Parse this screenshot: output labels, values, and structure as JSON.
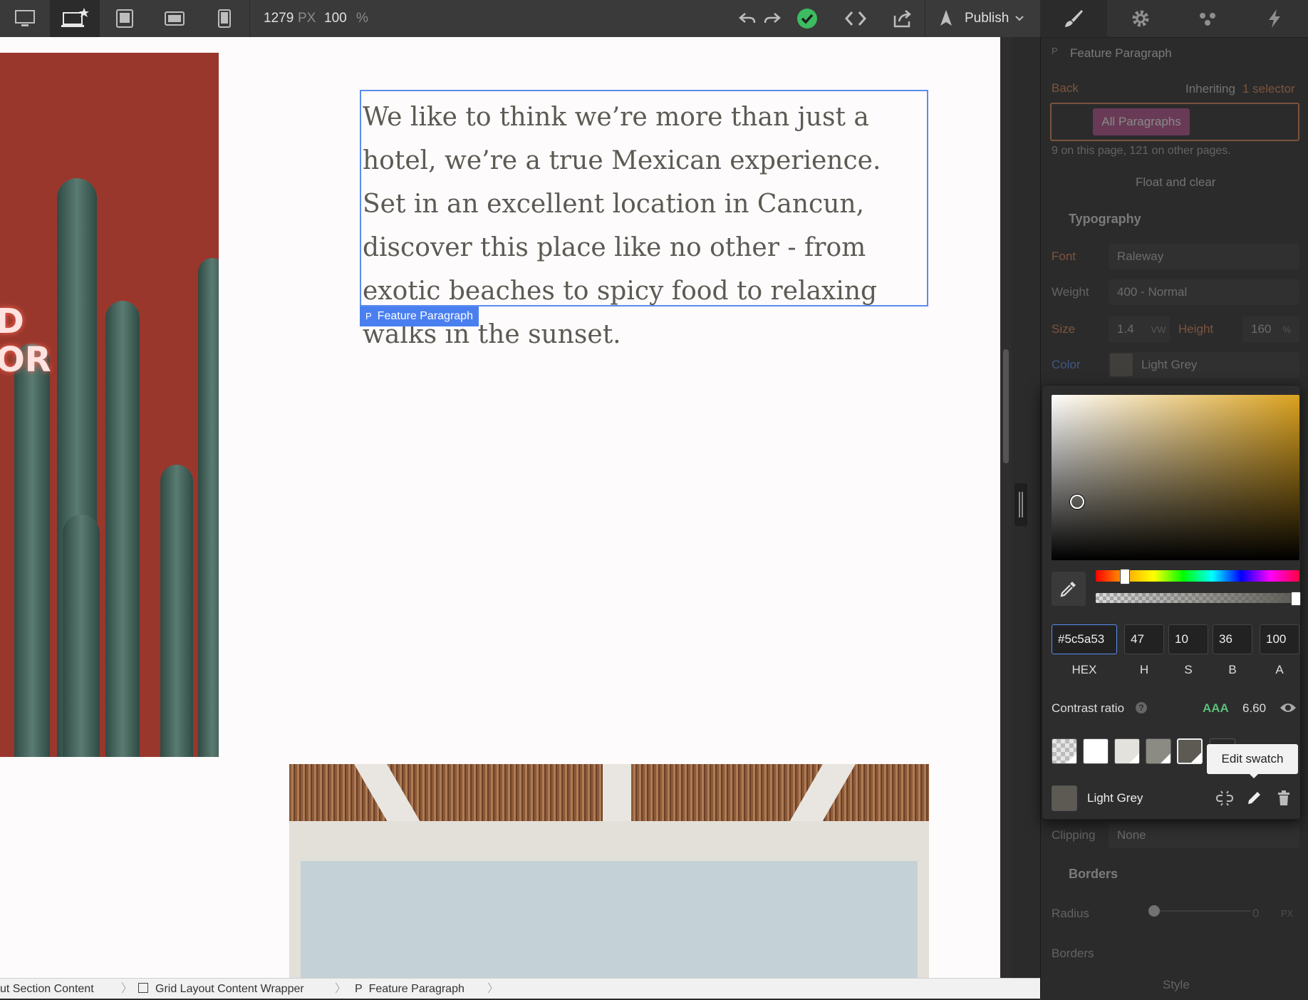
{
  "toolbar": {
    "width_value": "1279",
    "width_unit": "PX",
    "zoom_value": "100",
    "zoom_unit": "%",
    "publish_label": "Publish",
    "status_color": "#3dbb61"
  },
  "canvas": {
    "paragraph_text": "We like to think we’re more than just a hotel, we’re a true Mexican experience. Set in an excellent location in Cancun, discover this place like no other - from exotic beaches to spicy food to relaxing walks in the sunset.",
    "paragraph_badge_tag": "P",
    "paragraph_badge_label": "Feature Paragraph",
    "neon_sign_letters": "D\nOR"
  },
  "breadcrumb": {
    "items": [
      {
        "label": "ut Section Content"
      },
      {
        "label": "Grid Layout Content Wrapper"
      },
      {
        "label": "Feature Paragraph",
        "tag": "P"
      }
    ]
  },
  "panel": {
    "selector_tag": "P",
    "selector_name": "Feature Paragraph",
    "back_label": "Back",
    "inheriting_label": "Inheriting",
    "inheriting_count": "1 selector",
    "class_chip": "All Paragraphs",
    "usage_note": "9 on this page, 121 on other pages.",
    "float_clear": "Float and clear",
    "typography_title": "Typography",
    "font_label": "Font",
    "font_value": "Raleway",
    "weight_label": "Weight",
    "weight_value": "400 - Normal",
    "size_label": "Size",
    "size_value": "1.4",
    "size_unit": "VW",
    "height_label": "Height",
    "height_value": "160",
    "height_unit": "%",
    "color_label": "Color",
    "color_value": "Light Grey",
    "clipping_label": "Clipping",
    "clipping_value": "None",
    "borders_title": "Borders",
    "radius_label": "Radius",
    "radius_value": "0",
    "radius_unit": "PX",
    "borders_label": "Borders",
    "style_label": "Style"
  },
  "picker": {
    "hex": "#5c5a53",
    "h": "47",
    "s": "10",
    "b": "36",
    "a": "100",
    "hex_label": "HEX",
    "h_label": "H",
    "s_label": "S",
    "b_label": "B",
    "a_label": "A",
    "contrast_label": "Contrast ratio",
    "contrast_grade": "AAA",
    "contrast_value": "6.60",
    "tooltip": "Edit swatch",
    "swatch_name": "Light Grey",
    "hue_fraction": 0.13,
    "alpha_fraction": 1.0,
    "saturation_fraction": 0.1,
    "brightness_fraction": 0.36,
    "swatch_colors": [
      "transparent",
      "#ffffff",
      "#e4e2dc",
      "#8b8a83",
      "#5c5a53",
      "#2a2a2a"
    ],
    "accent_color": "#5c5a53",
    "grade_color": "#5cbf7a"
  }
}
